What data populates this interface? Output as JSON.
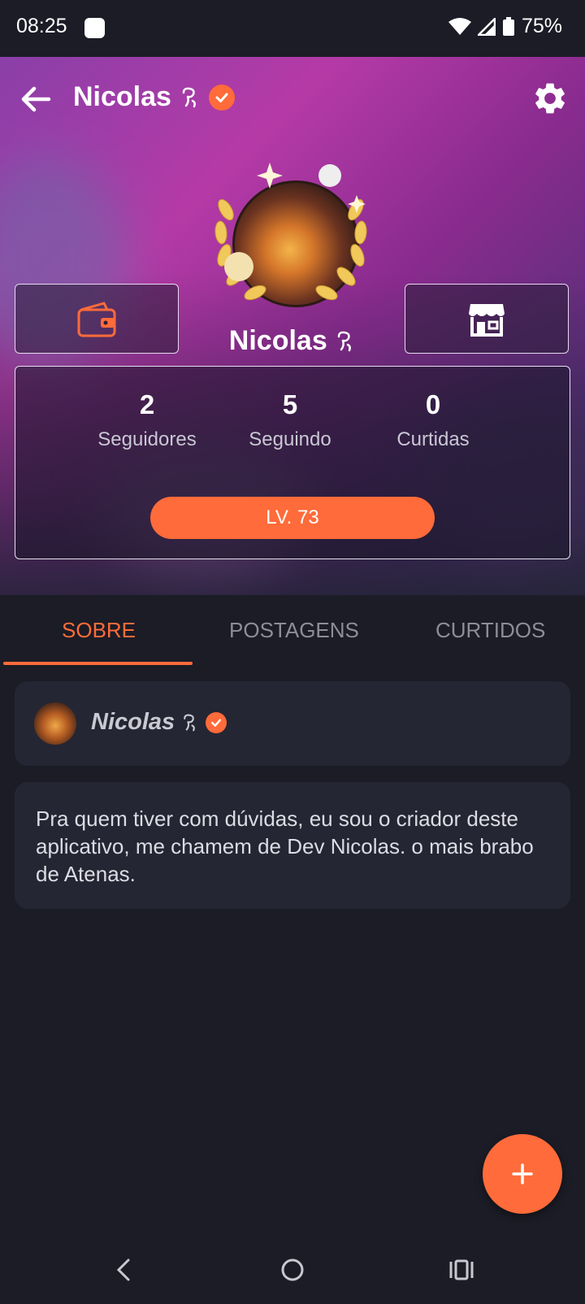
{
  "status_bar": {
    "time": "08:25",
    "battery": "75%"
  },
  "header": {
    "title": "Nicolas"
  },
  "profile": {
    "name": "Nicolas",
    "level": "LV. 73"
  },
  "stats": [
    {
      "value": "2",
      "label": "Seguidores"
    },
    {
      "value": "5",
      "label": "Seguindo"
    },
    {
      "value": "0",
      "label": "Curtidas"
    }
  ],
  "tabs": [
    {
      "label": "SOBRE",
      "active": true
    },
    {
      "label": "POSTAGENS",
      "active": false
    },
    {
      "label": "CURTIDOS",
      "active": false
    }
  ],
  "about": {
    "author_name": "Nicolas",
    "bio": "Pra quem tiver com dúvidas, eu sou o criador deste aplicativo, me chamem de Dev Nicolas. o mais brabo de Atenas."
  },
  "colors": {
    "accent": "#ff6b3a",
    "background": "#1b1c26",
    "card": "#252633"
  },
  "icons": {
    "back": "arrow-left-icon",
    "settings": "gear-icon",
    "wallet": "wallet-icon",
    "store": "store-icon",
    "verified": "verified-badge-icon",
    "add": "plus-icon"
  }
}
